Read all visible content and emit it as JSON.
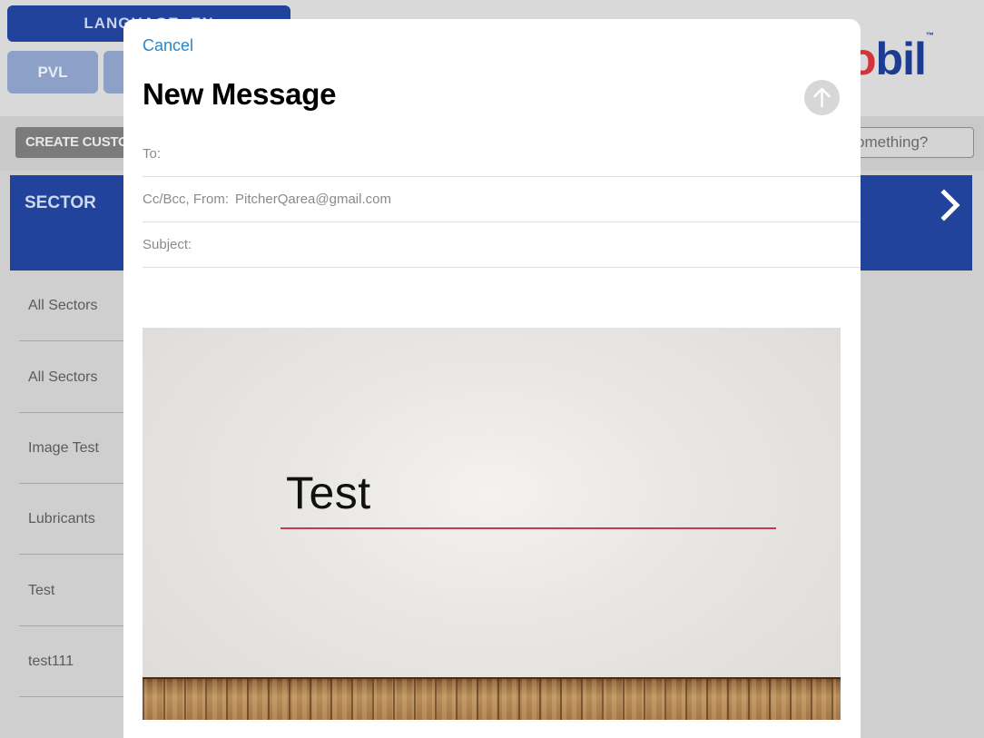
{
  "background_app": {
    "language_button": "LANGUAGE: EN",
    "pvl_button": "PVL",
    "logo": {
      "text_prefix": "o",
      "text_suffix": "bil",
      "trademark": "™"
    },
    "create_button": "CREATE CUSTOM",
    "search_placeholder": "omething?",
    "sector_header": "SECTOR",
    "sector_items": [
      "All Sectors",
      "All Sectors",
      "Image Test",
      "Lubricants",
      "Test",
      "test111"
    ]
  },
  "compose": {
    "cancel_label": "Cancel",
    "title": "New Message",
    "to_label": "To:",
    "cc_from_label": "Cc/Bcc, From:",
    "from_email": "PitcherQarea@gmail.com",
    "subject_label": "Subject:",
    "attachment": {
      "slide_title": "Test"
    }
  },
  "colors": {
    "brand_blue": "#21439b",
    "accent_blue": "#2b86c9",
    "slide_rule_red": "#c9384e"
  },
  "icons": {
    "send": "arrow-up-icon",
    "sector_next": "chevron-right-icon"
  }
}
